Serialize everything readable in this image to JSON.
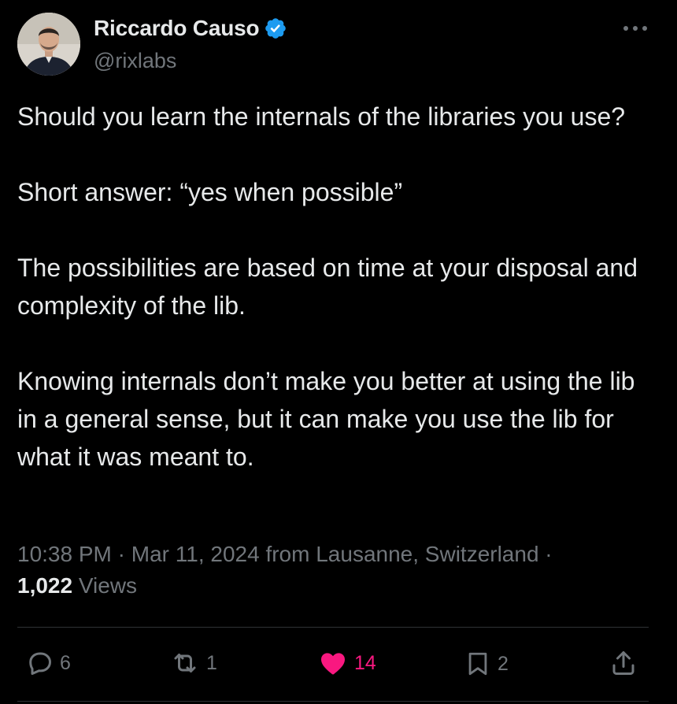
{
  "author": {
    "display_name": "Riccardo Causo",
    "handle": "@rixlabs",
    "verified_icon": "verified-badge-icon",
    "verified_color": "#1d9bf0"
  },
  "more_icon": "more-horizontal-icon",
  "body": {
    "paragraphs": [
      "Should you learn the internals of the libraries you use?",
      "Short answer: “yes when possible”",
      "The possibilities are based on time at your disposal and complexity of the lib.",
      "Knowing internals don’t make you better at using the lib in a general sense, but it can make you use the lib for what it was meant to."
    ]
  },
  "meta": {
    "time": "10:38 PM",
    "separator": " · ",
    "date": "Mar 11, 2024",
    "location": "from Lausanne, Switzerland",
    "views_count": "1,022",
    "views_label": "Views"
  },
  "actions": {
    "reply": {
      "icon": "reply-icon",
      "count": "6"
    },
    "repost": {
      "icon": "repost-icon",
      "count": "1"
    },
    "like": {
      "icon": "heart-icon",
      "count": "14",
      "liked": true,
      "color": "#f91880"
    },
    "bookmark": {
      "icon": "bookmark-icon",
      "count": "2"
    },
    "share": {
      "icon": "share-icon"
    }
  },
  "colors": {
    "background": "#000000",
    "text_primary": "#e7e9ea",
    "text_secondary": "#71767b",
    "divider": "#2f3336"
  }
}
